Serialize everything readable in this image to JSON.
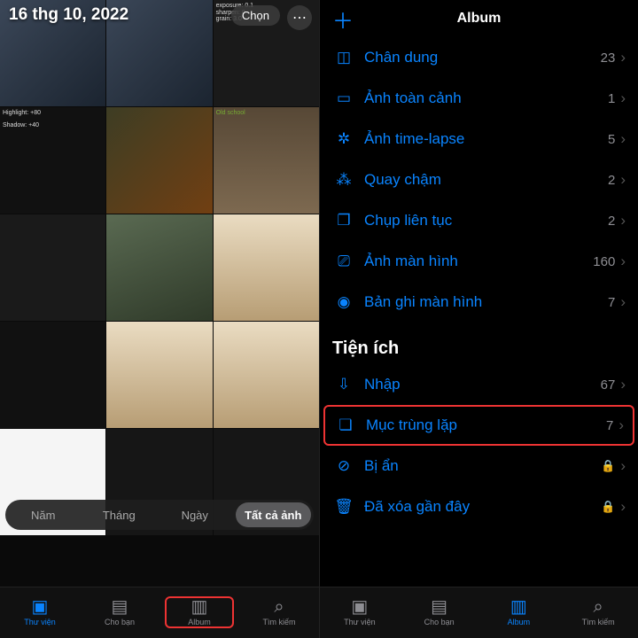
{
  "left": {
    "date": "16 thg 10, 2022",
    "select_label": "Chọn",
    "segments": {
      "year": "Năm",
      "month": "Tháng",
      "day": "Ngày",
      "all": "Tất cả ảnh"
    },
    "highlight_text": "Highlight: +80",
    "shadow_text": "Shadow: +40",
    "old_school": "Old school"
  },
  "right": {
    "header_title": "Album",
    "rows_media": [
      {
        "icon": "portrait-icon",
        "glyph": "◫",
        "label": "Chân dung",
        "count": "23"
      },
      {
        "icon": "panorama-icon",
        "glyph": "▭",
        "label": "Ảnh toàn cảnh",
        "count": "1"
      },
      {
        "icon": "timelapse-icon",
        "glyph": "✲",
        "label": "Ảnh time-lapse",
        "count": "5"
      },
      {
        "icon": "slomo-icon",
        "glyph": "⁂",
        "label": "Quay chậm",
        "count": "2"
      },
      {
        "icon": "burst-icon",
        "glyph": "❐",
        "label": "Chụp liên tục",
        "count": "2"
      },
      {
        "icon": "screenshot-icon",
        "glyph": "⎚",
        "label": "Ảnh màn hình",
        "count": "160"
      },
      {
        "icon": "screenrec-icon",
        "glyph": "◉",
        "label": "Bản ghi màn hình",
        "count": "7"
      }
    ],
    "section_util": "Tiện ích",
    "rows_util": [
      {
        "icon": "import-icon",
        "glyph": "⇩",
        "label": "Nhập",
        "count": "67",
        "hl": false,
        "lock": false
      },
      {
        "icon": "duplicate-icon",
        "glyph": "❏",
        "label": "Mục trùng lặp",
        "count": "7",
        "hl": true,
        "lock": false
      },
      {
        "icon": "hidden-icon",
        "glyph": "⊘",
        "label": "Bị ẩn",
        "count": "",
        "hl": false,
        "lock": true
      },
      {
        "icon": "trash-icon",
        "glyph": "🗑",
        "label": "Đã xóa gần đây",
        "count": "",
        "hl": false,
        "lock": true
      }
    ]
  },
  "tabs": {
    "library": "Thư viện",
    "foryou": "Cho bạn",
    "album": "Album",
    "search": "Tìm kiếm"
  }
}
